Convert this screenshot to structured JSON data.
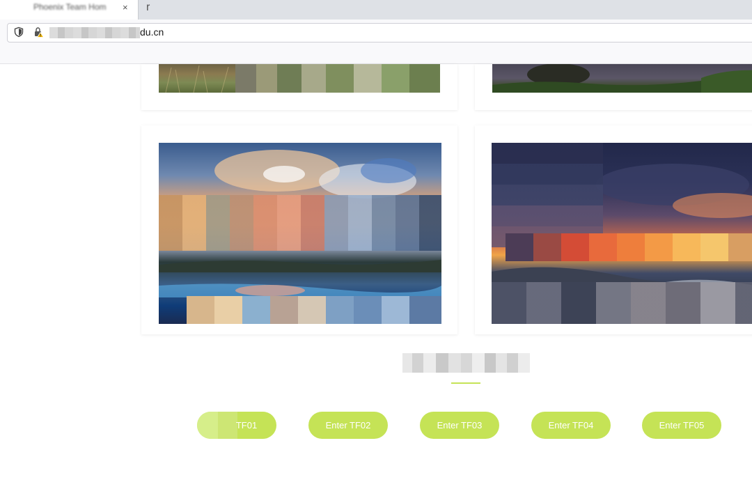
{
  "browser": {
    "tab_title": "Phoenix Team Hom",
    "tab_close_glyph": "×",
    "new_tab_glyph": "r",
    "url_suffix": "du.cn",
    "icons": [
      "shield-icon",
      "lock-warning-icon",
      "close-icon"
    ]
  },
  "page": {
    "section_title": "",
    "accent_color": "#c5e356",
    "buttons": [
      {
        "label": "TF01"
      },
      {
        "label": "Enter TF02"
      },
      {
        "label": "Enter TF03"
      },
      {
        "label": "Enter TF04"
      },
      {
        "label": "Enter TF05"
      }
    ]
  }
}
